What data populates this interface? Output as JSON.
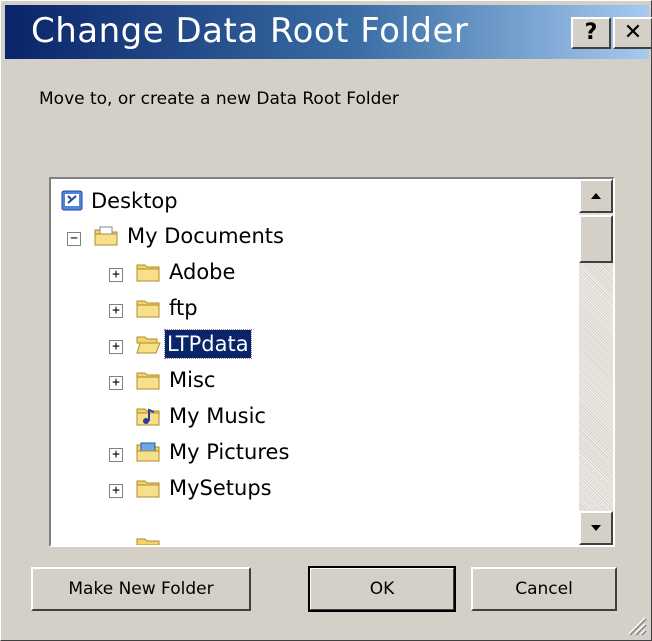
{
  "window": {
    "title": "Change Data Root Folder",
    "help_label": "?",
    "close_label": "✕"
  },
  "instruction": "Move to, or create a new Data Root Folder",
  "tree": {
    "items": [
      {
        "label": "Desktop",
        "icon": "desktop-icon",
        "expander": ""
      },
      {
        "label": "My Documents",
        "icon": "documents-folder-icon",
        "expander": "−"
      },
      {
        "label": "Adobe",
        "icon": "folder-icon",
        "expander": "+"
      },
      {
        "label": "ftp",
        "icon": "folder-icon",
        "expander": "+"
      },
      {
        "label": "LTPdata",
        "icon": "open-folder-icon",
        "expander": "+",
        "selected": true
      },
      {
        "label": "Misc",
        "icon": "folder-icon",
        "expander": "+"
      },
      {
        "label": "My Music",
        "icon": "music-folder-icon",
        "expander": ""
      },
      {
        "label": "My Pictures",
        "icon": "pictures-folder-icon",
        "expander": "+"
      },
      {
        "label": "MySetups",
        "icon": "folder-icon",
        "expander": "+"
      }
    ]
  },
  "buttons": {
    "make_new_folder": "Make New Folder",
    "ok": "OK",
    "cancel": "Cancel"
  },
  "colors": {
    "face": "#d4d0c8",
    "title_start": "#0a246a",
    "title_end": "#a6caf0",
    "selection": "#0a246a",
    "folder": "#f4d36b"
  }
}
